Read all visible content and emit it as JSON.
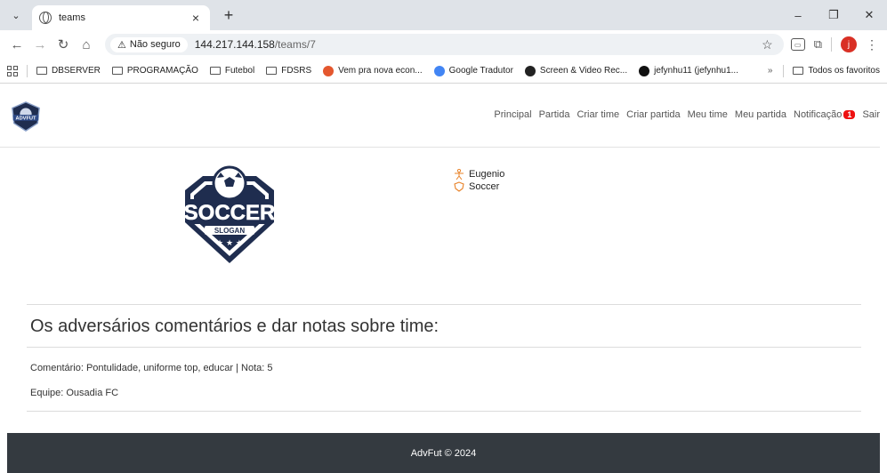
{
  "browser": {
    "tab_title": "teams",
    "insecure_label": "Não seguro",
    "url_host": "144.217.144.158",
    "url_path": "/teams/7",
    "profile_initial": "j",
    "bookmarks": [
      {
        "label": "DBSERVER",
        "type": "folder"
      },
      {
        "label": "PROGRAMAÇÃO",
        "type": "folder"
      },
      {
        "label": "Futebol",
        "type": "folder"
      },
      {
        "label": "FDSRS",
        "type": "folder"
      },
      {
        "label": "Vem pra nova econ...",
        "type": "site",
        "color": "#e4572e"
      },
      {
        "label": "Google Tradutor",
        "type": "site",
        "color": "#4285f4"
      },
      {
        "label": "Screen & Video Rec...",
        "type": "site",
        "color": "#222222"
      },
      {
        "label": "jefynhu11 (jefynhu1...",
        "type": "site",
        "color": "#111111"
      }
    ],
    "more_bookmarks": "»",
    "all_favorites": "Todos os favoritos"
  },
  "nav": {
    "links": [
      "Principal",
      "Partida",
      "Criar time",
      "Criar partida",
      "Meu time",
      "Meu partida",
      "Notificação"
    ],
    "notification_count": "1",
    "logout": "Sair"
  },
  "team": {
    "owner": "Eugenio",
    "sport": "Soccer",
    "logo_text": "SOCCER",
    "logo_slogan": "SLOGAN"
  },
  "reviews": {
    "title": "Os adversários comentários e dar notas sobre time:",
    "comment_line": "Comentário: Pontulidade, uniforme top, educar | Nota: 5",
    "team_line": "Equipe: Ousadia FC"
  },
  "footer": {
    "text": "AdvFut © 2024"
  },
  "colors": {
    "footer_bg": "#343a40",
    "badge": "#ee1111",
    "logo_navy": "#1f2d4f",
    "icon_orange": "#e8832a"
  }
}
